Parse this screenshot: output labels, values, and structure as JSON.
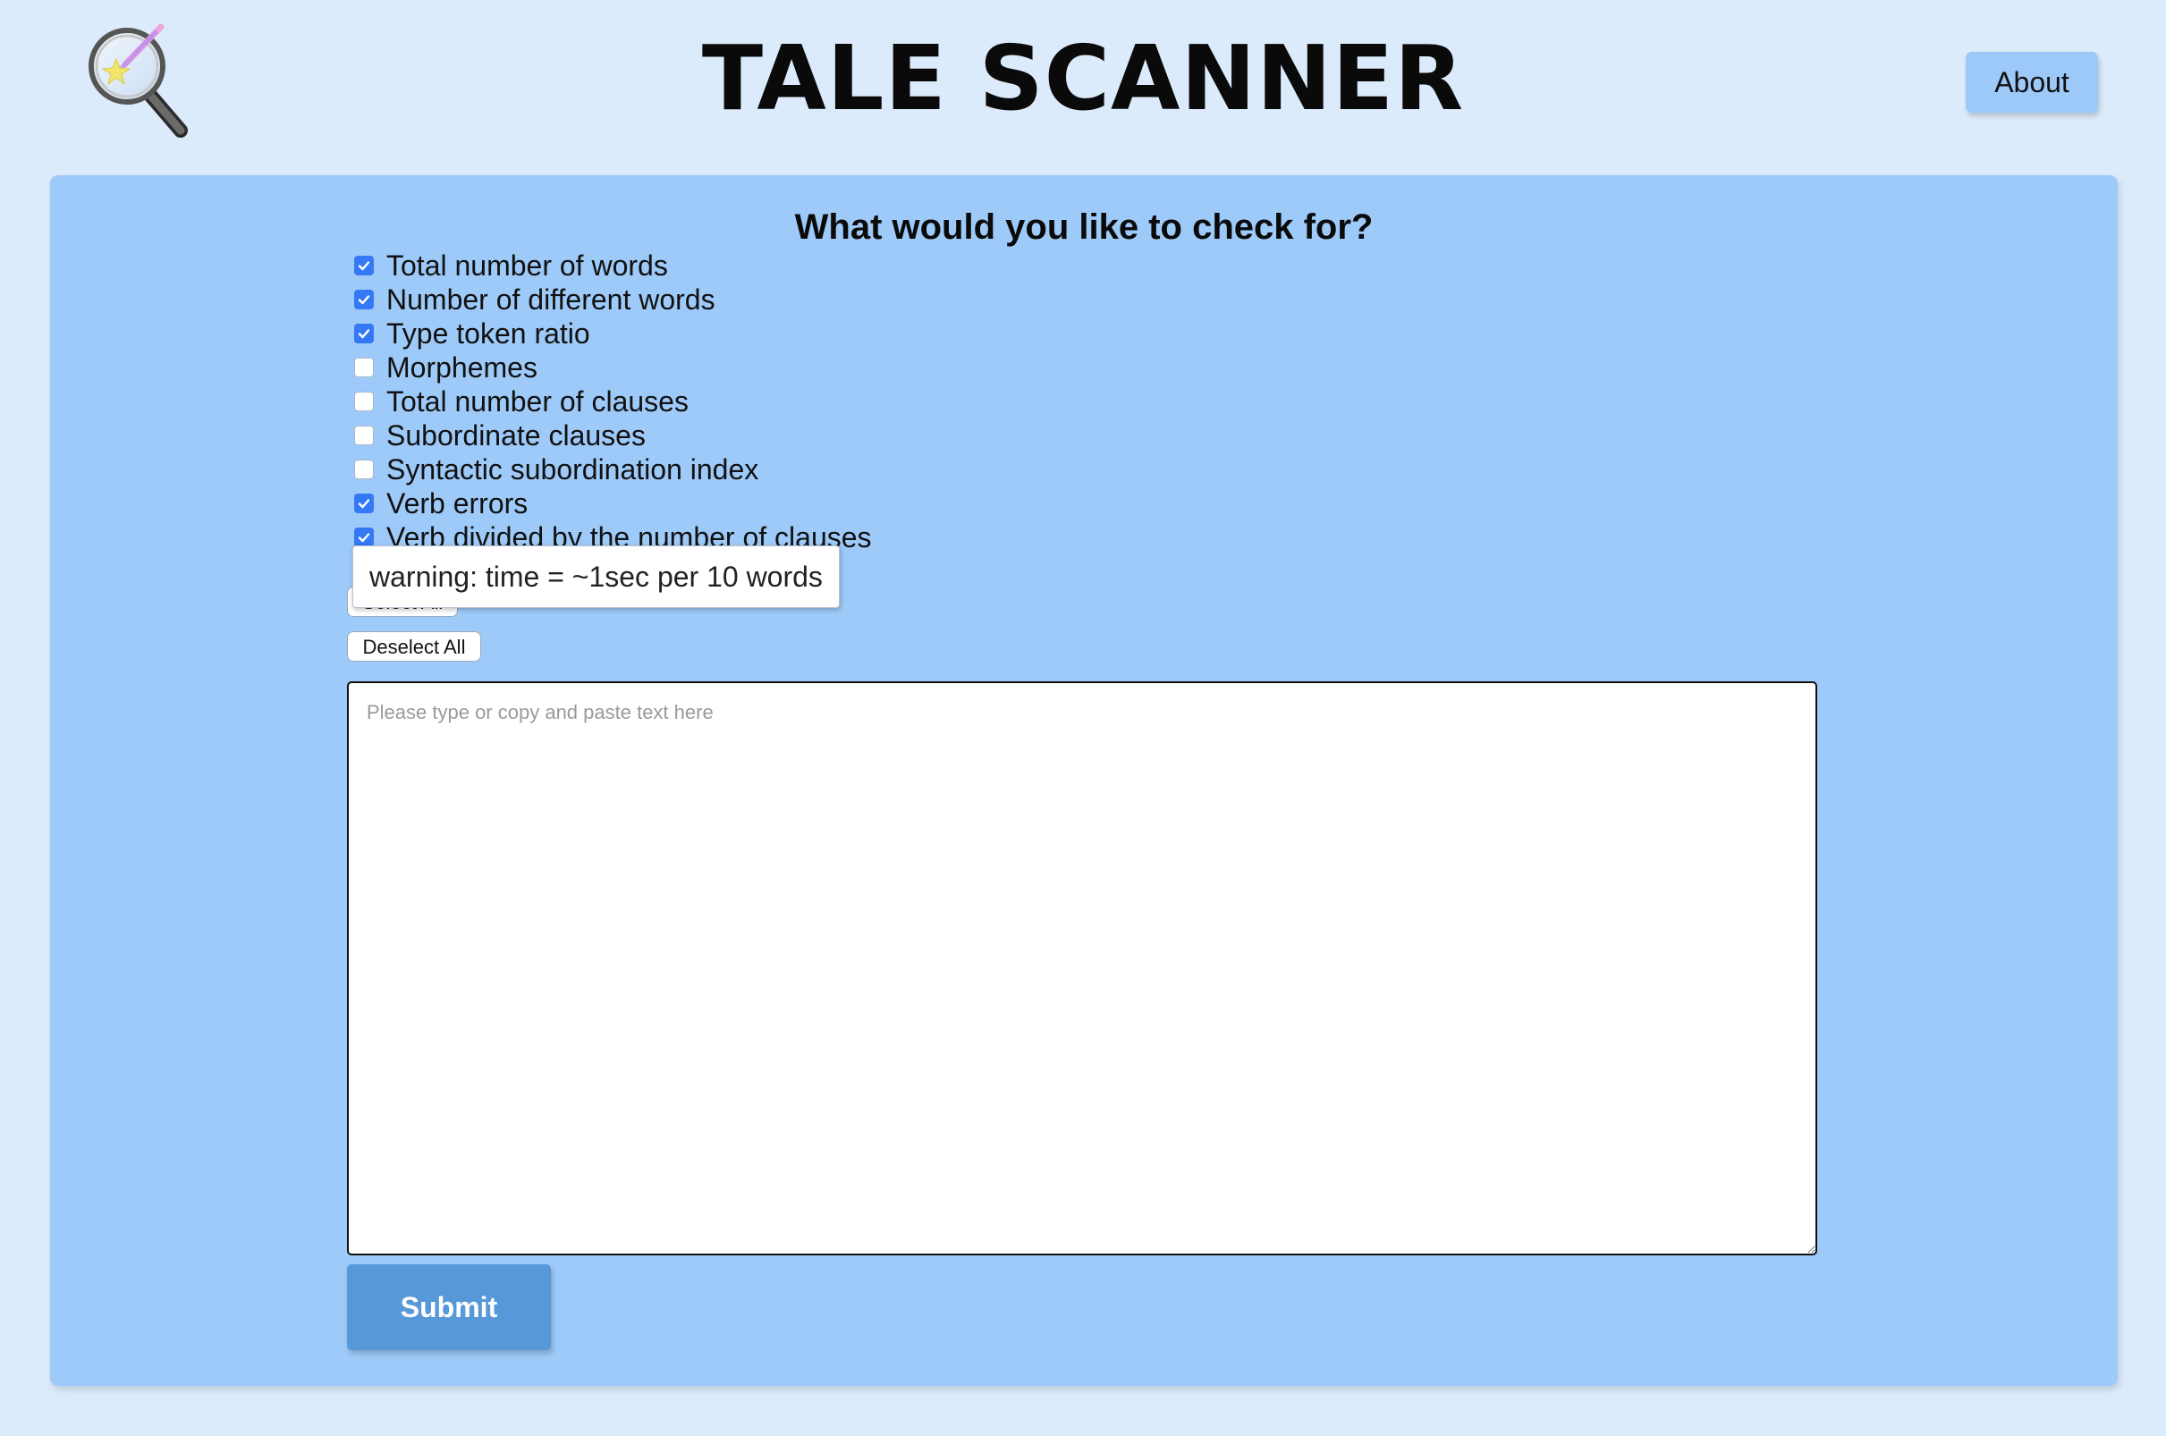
{
  "header": {
    "title": "TALE SCANNER",
    "logo_icon": "magnifying-glass-icon",
    "about_label": "About"
  },
  "panel": {
    "heading": "What would you like to check for?",
    "options": [
      {
        "label": "Total number of words",
        "checked": true
      },
      {
        "label": "Number of different words",
        "checked": true
      },
      {
        "label": "Type token ratio",
        "checked": true
      },
      {
        "label": "Morphemes",
        "checked": false
      },
      {
        "label": "Total number of clauses",
        "checked": false
      },
      {
        "label": "Subordinate clauses",
        "checked": false
      },
      {
        "label": "Syntactic subordination index",
        "checked": false
      },
      {
        "label": "Verb errors",
        "checked": true
      },
      {
        "label": "Verb divided by the number of clauses",
        "checked": true
      }
    ],
    "select_all_label": "Select All",
    "deselect_all_label": "Deselect All",
    "tooltip": "warning: time = ~1sec per 10 words",
    "input": {
      "placeholder": "Please type or copy and paste text here",
      "value": ""
    },
    "submit_label": "Submit"
  },
  "colors": {
    "page_background": "#dcebfb",
    "panel_background": "#9ecaf9",
    "about_button": "#9cc9f8",
    "submit_button": "#5698d8",
    "checkbox_checked": "#3478f6"
  }
}
